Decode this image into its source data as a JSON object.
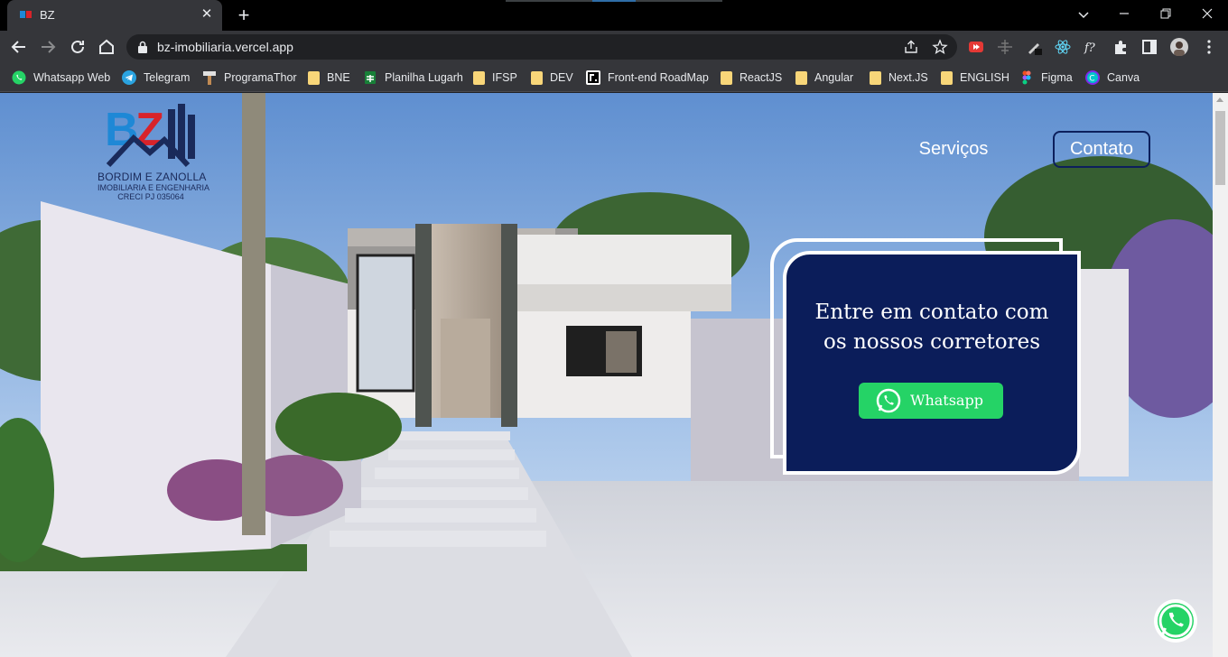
{
  "browser": {
    "tab": {
      "title": "BZ"
    },
    "url": "bz-imobiliaria.vercel.app",
    "bookmarks": [
      {
        "label": "Whatsapp Web",
        "icon": "whatsapp-icon"
      },
      {
        "label": "Telegram",
        "icon": "telegram-icon"
      },
      {
        "label": "ProgramaThor",
        "icon": "hammer-icon"
      },
      {
        "label": "BNE",
        "icon": "folder-icon"
      },
      {
        "label": "Planilha Lugarh",
        "icon": "sheets-icon"
      },
      {
        "label": "IFSP",
        "icon": "folder-icon"
      },
      {
        "label": "DEV",
        "icon": "folder-icon"
      },
      {
        "label": "Front-end RoadMap",
        "icon": "roadmap-icon"
      },
      {
        "label": "ReactJS",
        "icon": "folder-icon"
      },
      {
        "label": "Angular",
        "icon": "folder-icon"
      },
      {
        "label": "Next.JS",
        "icon": "folder-icon"
      },
      {
        "label": "ENGLISH",
        "icon": "folder-icon"
      },
      {
        "label": "Figma",
        "icon": "figma-icon"
      },
      {
        "label": "Canva",
        "icon": "canva-icon"
      }
    ]
  },
  "site": {
    "logo": {
      "mark": "BZ",
      "line1": "BORDIM E ZANOLLA",
      "line2": "IMOBILIARIA E ENGENHARIA",
      "line3": "CRECI PJ 035064"
    },
    "nav": {
      "servicos": "Serviços",
      "contato": "Contato"
    },
    "contact_card": {
      "heading_line1": "Entre em contato com",
      "heading_line2": "os nossos corretores",
      "button": "Whatsapp"
    },
    "colors": {
      "navy": "#0b1d5a",
      "whatsapp_green": "#25d366",
      "logo_blue": "#1e88d6",
      "logo_red": "#d8232a"
    }
  }
}
